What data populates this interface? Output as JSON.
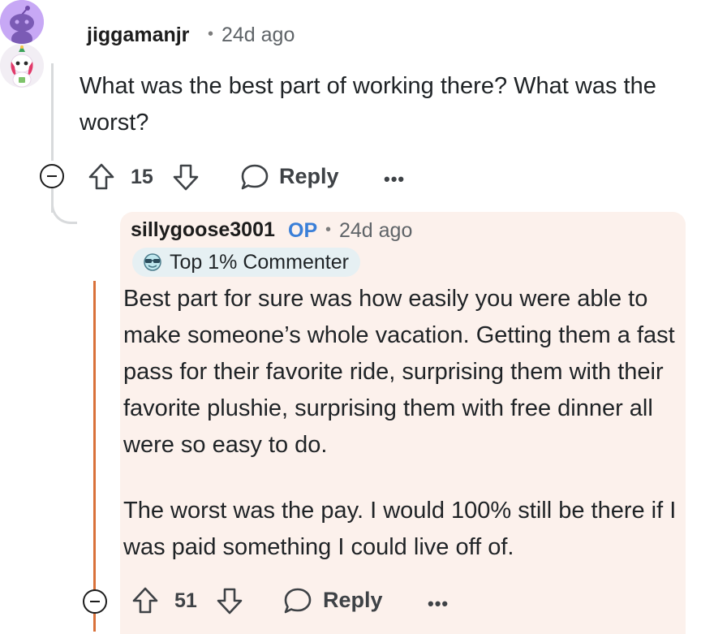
{
  "comment": {
    "username": "jiggamanjr",
    "time": "24d ago",
    "body": "What was the best part of working there? What was the worst?",
    "upvotes": "15",
    "reply_label": "Reply",
    "more_label": "•••"
  },
  "reply": {
    "username": "sillygoose3001",
    "op_tag": "OP",
    "time": "24d ago",
    "badge": "Top 1% Commenter",
    "paragraph1": "Best part for sure was how easily you were able to make someone’s whole vacation. Getting them a fast pass for their favorite ride, surprising them with their favorite plushie, surprising them with free dinner all were so easy to do.",
    "paragraph2": "The worst was the pay. I would 100% still be there if I was paid something I could live off of.",
    "upvotes": "51",
    "reply_label": "Reply",
    "more_label": "•••"
  },
  "colors": {
    "highlight_bg": "#fcf1ec",
    "op_accent": "#d9713a",
    "op_tag": "#3a7fd8",
    "badge_bg": "#e6f0f3"
  }
}
